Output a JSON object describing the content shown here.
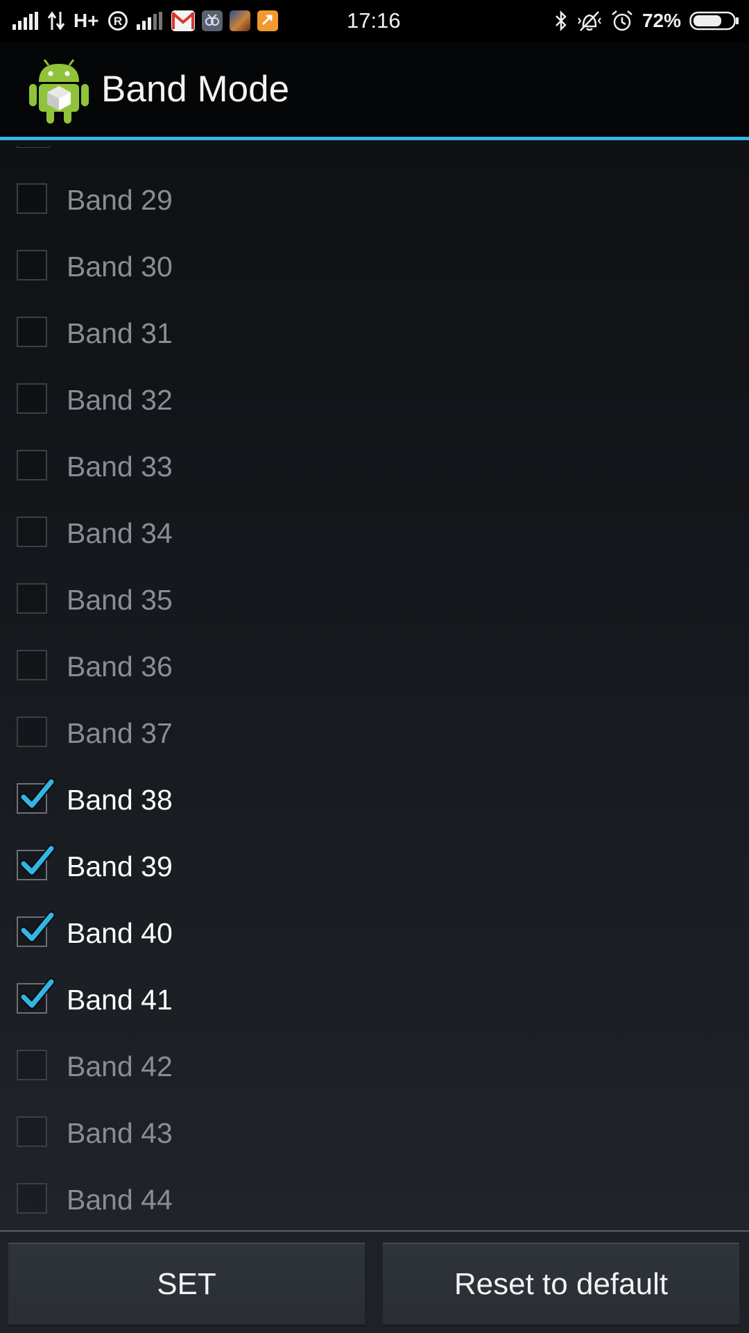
{
  "status_bar": {
    "network_type": "H+",
    "time": "17:16",
    "battery_percent": "72%",
    "battery_level": 0.72,
    "icons": [
      "signal-icon",
      "data-transfer-icon",
      "roaming-icon",
      "signal-icon-2",
      "gmail-icon",
      "app-notification-icon",
      "game-notification-icon",
      "app-notification-icon-orange",
      "bluetooth-icon",
      "vibrate-off-icon",
      "alarm-icon",
      "battery-icon"
    ]
  },
  "action_bar": {
    "title": "Band Mode",
    "icon": "android-app-icon",
    "accent_color": "#33b5e5"
  },
  "bands": [
    {
      "label": "Band 29",
      "checked": false
    },
    {
      "label": "Band 30",
      "checked": false
    },
    {
      "label": "Band 31",
      "checked": false
    },
    {
      "label": "Band 32",
      "checked": false
    },
    {
      "label": "Band 33",
      "checked": false
    },
    {
      "label": "Band 34",
      "checked": false
    },
    {
      "label": "Band 35",
      "checked": false
    },
    {
      "label": "Band 36",
      "checked": false
    },
    {
      "label": "Band 37",
      "checked": false
    },
    {
      "label": "Band 38",
      "checked": true
    },
    {
      "label": "Band 39",
      "checked": true
    },
    {
      "label": "Band 40",
      "checked": true
    },
    {
      "label": "Band 41",
      "checked": true
    },
    {
      "label": "Band 42",
      "checked": false
    },
    {
      "label": "Band 43",
      "checked": false
    },
    {
      "label": "Band 44",
      "checked": false
    }
  ],
  "buttons": {
    "set_label": "SET",
    "reset_label": "Reset to default"
  }
}
